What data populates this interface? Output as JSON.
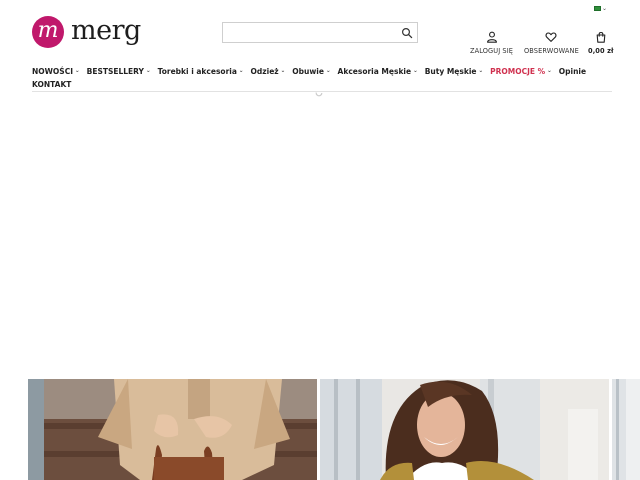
{
  "language": {
    "icon": "flag-icon"
  },
  "logo": {
    "mark_letter": "m",
    "text": "merg",
    "color": "#c0186b"
  },
  "search": {
    "value": "",
    "placeholder": "",
    "icon": "search-icon"
  },
  "header": {
    "login_label": "ZALOGUJ SIĘ",
    "favorites_label": "OBSERWOWANE",
    "cart_label": "0,00 zł"
  },
  "nav": {
    "items": [
      {
        "label": "NOWOŚCI",
        "dropdown": true
      },
      {
        "label": "BESTSELLERY",
        "dropdown": true
      },
      {
        "label": "Torebki i akcesoria",
        "dropdown": true
      },
      {
        "label": "Odzież",
        "dropdown": true
      },
      {
        "label": "Obuwie",
        "dropdown": true
      },
      {
        "label": "Akcesoria Męskie",
        "dropdown": true
      },
      {
        "label": "Buty Męskie",
        "dropdown": true
      },
      {
        "label": "PROMOCJE %",
        "dropdown": true
      },
      {
        "label": "Opinie",
        "dropdown": false
      },
      {
        "label": "KONTAKT",
        "dropdown": false
      }
    ],
    "promo_color": "#d0314f"
  },
  "banners": [
    {
      "icon": "banner-image-woman-with-bag"
    },
    {
      "icon": "banner-image-smiling-woman"
    },
    {
      "icon": "banner-image-partial"
    }
  ]
}
